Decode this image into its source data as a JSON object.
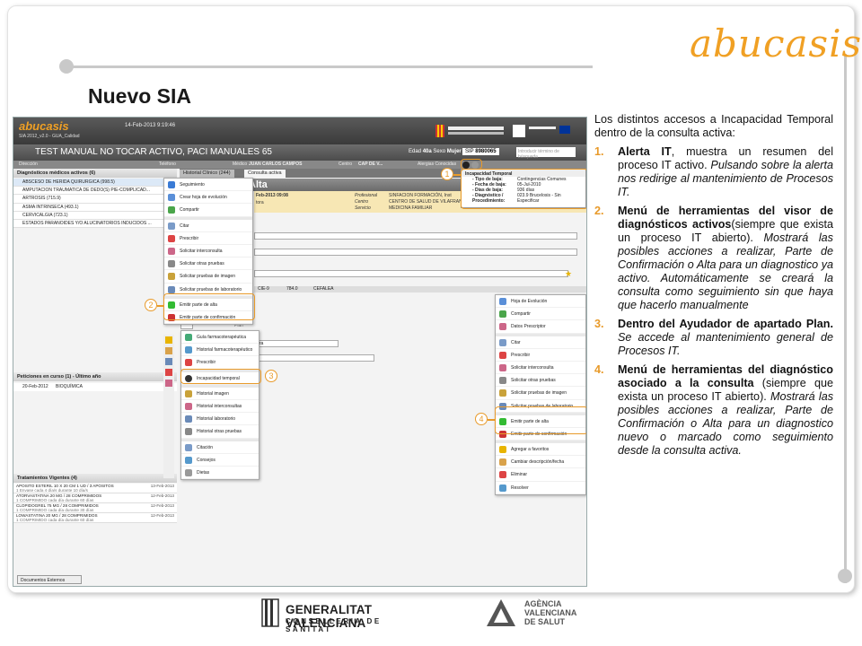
{
  "brand": {
    "logo_text": "abucasis",
    "accent": "#e89a2a",
    "logo_color": "#f0a024"
  },
  "slide_title": "Nuevo SIA",
  "description": {
    "intro": "Los distintos accesos a Incapacidad Temporal dentro de la consulta activa:",
    "items": [
      {
        "num": "1.",
        "bold": "Alerta IT",
        "rest": ", muestra un resumen del proceso IT activo. ",
        "italic": "Pulsando sobre la alerta nos redirige al mantenimiento de Procesos IT."
      },
      {
        "num": "2.",
        "bold": "Menú de herramientas del visor de diagnósticos activos",
        "rest": "(siempre que exista un proceso IT abierto). ",
        "italic": "Mostrará las posibles acciones a realizar, Parte de Confirmación o Alta para un diagnostico ya activo. Automáticamente se creará la consulta como seguimiento sin que haya que hacerlo manualmente"
      },
      {
        "num": "3.",
        "bold": "Dentro del Ayudador de apartado Plan.",
        "rest": " ",
        "italic": "Se accede al mantenimiento general de Procesos IT."
      },
      {
        "num": "4.",
        "bold": "Menú de herramientas del diagnóstico asociado a la consulta",
        "rest": " (siempre que exista un proceso IT abierto). ",
        "italic": "Mostrará las posibles acciones a realizar, Parte de Confirmación o Alta para un diagnostico nuevo o marcado como seguimiento desde la consulta activa."
      }
    ]
  },
  "footer": {
    "gv_line1": "GENERALITAT VALENCIANA",
    "gv_line2": "CONSELLERIA DE SANITAT",
    "avs_line1": "AGÈNCIA",
    "avs_line2": "VALENCIANA",
    "avs_line3": "DE SALUT"
  },
  "app": {
    "logo": "abucasis",
    "logo_sub": "SIA 2012_v2.0 - GUA_Calidad",
    "datetime": "14-Feb-2013 9:19:46",
    "patient": "TEST MANUAL NO TOCAR ACTIVO, PACI MANUALES 65",
    "edad_label": "Edad",
    "edad": "40a",
    "sexo_label": "Sexo",
    "sexo": "Mujer",
    "sip_label": "SIP",
    "sip": "8980065",
    "search_placeholder": "Introducir término de búsqueda",
    "info_direccion": "Dirección",
    "info_telefono": "Teléfono",
    "info_medico": "Médico",
    "medico": "JUAN CARLOS CAMPOS",
    "info_centro": "Centro",
    "centro": "CAP DE V...",
    "alergias": "Alergias Conocidas",
    "tab_historial": "Historial Clínico (244)",
    "tab_consulta": "Consulta activa",
    "consulta_title": "Alta",
    "consulta_date": "Feb-2013 09:08",
    "consulta_sub": "tora",
    "consulta_prof_label": "Profesional",
    "consulta_prof": "SINFACION FORMACIÓN, Inst",
    "consulta_centro_label": "Centro",
    "consulta_centro": "CENTRO DE SALUD DE VILAFRANQUEST",
    "consulta_serv_label": "Servicio",
    "consulta_serv": "MEDICINA FAMILIAR",
    "cie_label": "CIE-9",
    "cie_code": "784.0",
    "cie_desc": "CEFALEA",
    "plan_label": "Plan",
    "select_value": "era",
    "diag_header": "Diagnósticos médicos activos  (6)",
    "diagnoses": [
      "ABSCESO DE HERIDA QUIRURGICA (998.5)",
      "AMPUTACION TRAUMATICA DE DEDO(S) PIE-COMPLICAD...",
      "ARTROSIS (715.9)",
      "ASMA INTRINSECA (493.1)",
      "CERVICALGIA (723.1)",
      "ESTADOS PARANOIDES Y/O ALUCINATORIOS INDUCIDOS ..."
    ],
    "peticiones_header": "Peticiones en curso (1) - Último año",
    "peticion_date": "20-Feb-2012",
    "peticion_desc": "BIOQUÍMICA",
    "treat_header": "Tratamientos Vigentes (4)",
    "treatments": [
      {
        "name": "APOSITO ESTERIL 10 X 20 CM 1 UD / 3 APOSITOS",
        "sub": "1 Envase cada 4 día/s durante 10 día/s",
        "date": "13-Feb-2013"
      },
      {
        "name": "ATORVASTATINA 20 MG / 28 COMPRIMIDOS",
        "sub": "1 COMPRIMIDO cada día durante 60 días",
        "date": "12-Feb-2013"
      },
      {
        "name": "CLOPIDOGREL 75 MG / 28 COMPRIMIDOS",
        "sub": "1 COMPRIMIDO cada día durante 30 días",
        "date": "12-Feb-2013"
      },
      {
        "name": "LOWASTATINA 20 MG / 28 COMPRIMIDOS",
        "sub": "1 COMPRIMIDO cada día durante 60 días",
        "date": "12-Feb-2013"
      }
    ],
    "docs_button": "Documentos Externos",
    "it_popup": {
      "title": "Incapacidad Temporal",
      "rows": [
        {
          "k": "- Tipo de baja:",
          "v": "Contingencias Comunes"
        },
        {
          "k": "- Fecha de baja:",
          "v": "05-Jul-2010"
        },
        {
          "k": "- Días de baja:",
          "v": "936 días"
        },
        {
          "k": "- Diagnóstico /",
          "v": "023.9 Brucelosis - Sin"
        },
        {
          "k": "Procedimiento:",
          "v": "Especificar"
        }
      ]
    },
    "menu_left": [
      "Seguimiento",
      "Crear hoja de evolución",
      "Compartir",
      "Citar",
      "Prescribir",
      "Solicitar interconsulta",
      "Solicitar otras pruebas",
      "Solicitar pruebas de imagen",
      "Solicitar pruebas de laboratorio",
      "Emitir parte de alta",
      "Emitir parte de confirmación"
    ],
    "menu_plan": [
      "Guía farmacoterapéutica",
      "Historial farmacoterapéutico",
      "Prescribir",
      "Incapacidad temporal",
      "Historial imagen",
      "Historial interconsultas",
      "Historial laboratorio",
      "Historial otras pruebas",
      "Citación",
      "Consejos",
      "Dietas"
    ],
    "menu_right": [
      "Hoja de Evolución",
      "Compartir",
      "Datos Prescriptor",
      "Citar",
      "Prescribir",
      "Solicitar interconsulta",
      "Solicitar otras pruebas",
      "Solicitar pruebas de imagen",
      "Solicitar pruebas de laboratorio",
      "Emitir parte de alta",
      "Emitir parte de confirmación",
      "Agregar a favoritos",
      "Cambiar descripción/fecha",
      "Eliminar",
      "Resolver"
    ],
    "badges": [
      "1",
      "2",
      "3",
      "4"
    ]
  }
}
